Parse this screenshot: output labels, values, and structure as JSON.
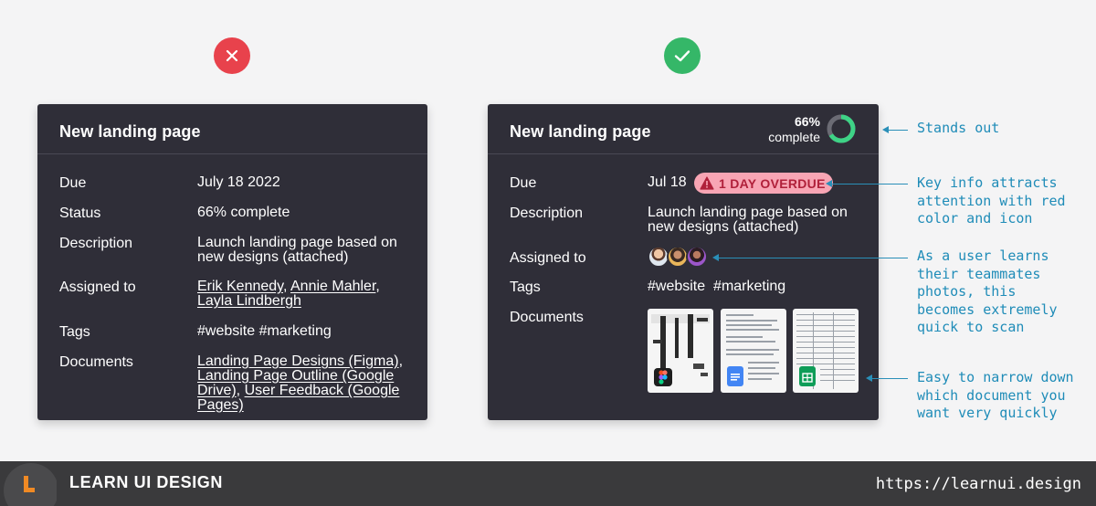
{
  "bad_example": {
    "icon": "x-icon",
    "color": "#e8424c",
    "title": "New landing page",
    "due_label": "Due",
    "due_value": "July 18 2022",
    "status_label": "Status",
    "status_value": "66% complete",
    "description_label": "Description",
    "description_line1": "Launch landing page based on",
    "description_line2": "new designs (attached)",
    "assigned_label": "Assigned to",
    "assignee_1": "Erik Kennedy",
    "assignee_2": "Annie Mahler",
    "assignee_3": "Layla Lindbergh",
    "tags_label": "Tags",
    "tags_value": "#website #marketing",
    "documents_label": "Documents",
    "doc_1_line1": "Landing Page Designs (Figma)",
    "doc_2_line1": "Landing Page Outline (Google",
    "doc_2_line2": "Drive)",
    "doc_3_line1": "User Feedback (Google",
    "doc_3_line2": "Pages)"
  },
  "good_example": {
    "icon": "check-icon",
    "color": "#35b768",
    "title": "New landing page",
    "progress_pct": "66%",
    "progress_label": "complete",
    "progress_fraction": 0.66,
    "due_label": "Due",
    "due_value": "Jul 18",
    "overdue_badge": "1 DAY OVERDUE",
    "description_label": "Description",
    "description_line1": "Launch landing page based on",
    "description_line2": "new designs (attached)",
    "assigned_label": "Assigned to",
    "tags_label": "Tags",
    "tag_1": "#website",
    "tag_2": "#marketing",
    "documents_label": "Documents"
  },
  "annotations": [
    "Stands out",
    "Key info attracts\nattention with red\ncolor and icon",
    "As a user learns\ntheir teammates\nphotos, this\nbecomes extremely\nquick to scan",
    "Easy to narrow down\nwhich document you\nwant very quickly"
  ],
  "footer": {
    "brand": "LEARN UI DESIGN",
    "url": "https://learnui.design",
    "logo_letter_color": "#f08a24"
  },
  "colors": {
    "card_bg": "#2f2e38",
    "annotation": "#1f8cb8",
    "overdue_bg": "#f8a5b4",
    "overdue_text": "#b0203a",
    "donut_fill": "#3ed386"
  }
}
